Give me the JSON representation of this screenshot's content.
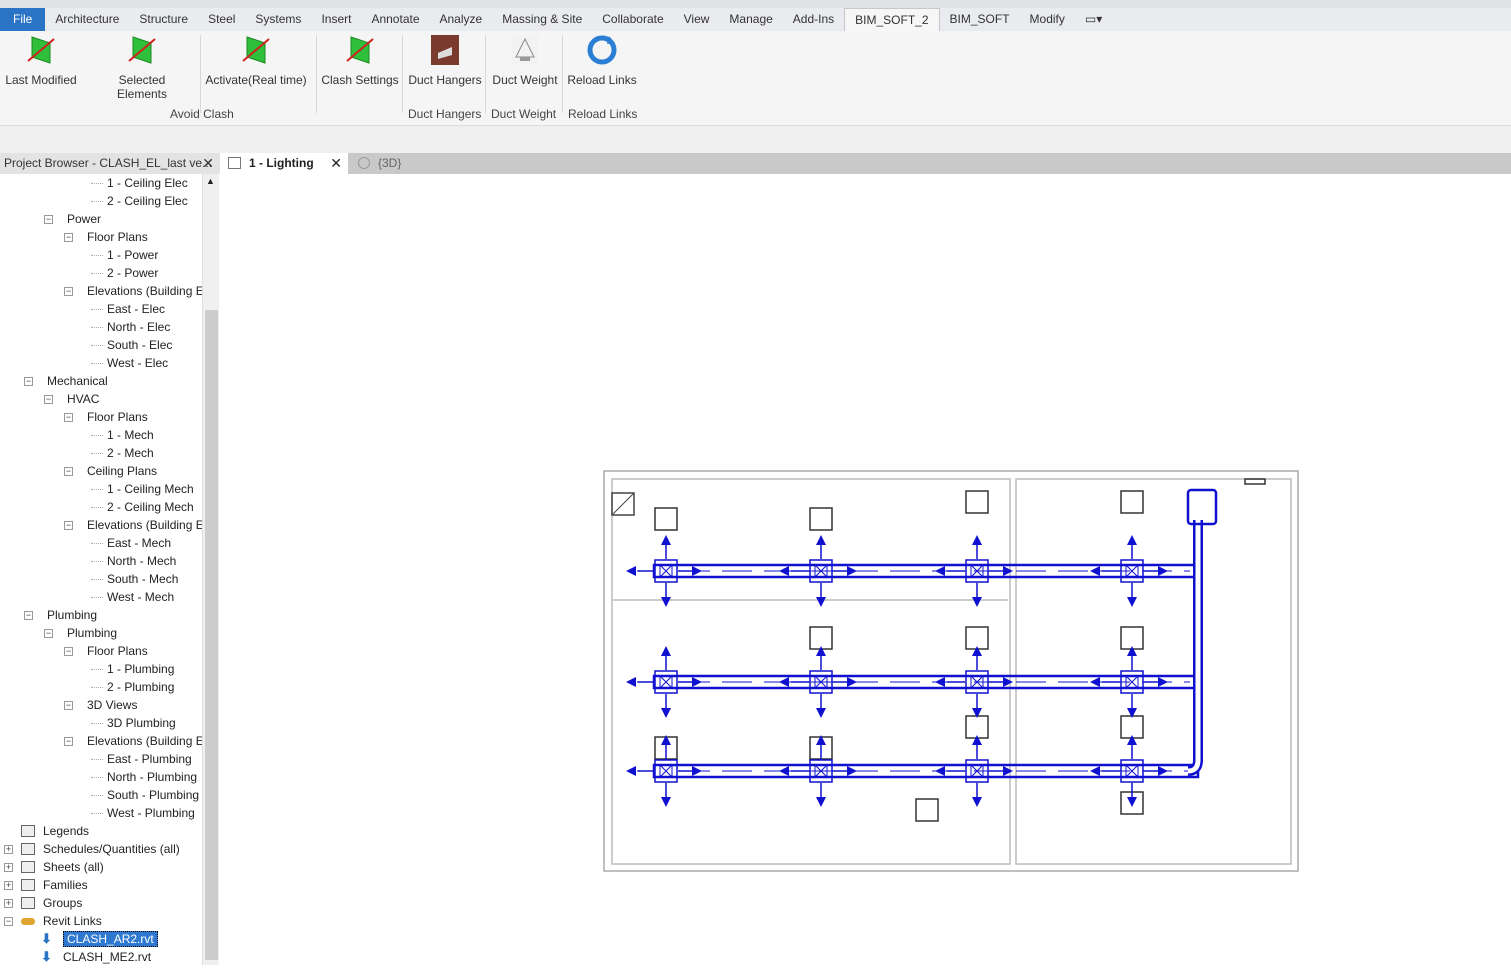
{
  "menu": {
    "tabs": [
      "File",
      "Architecture",
      "Structure",
      "Steel",
      "Systems",
      "Insert",
      "Annotate",
      "Analyze",
      "Massing & Site",
      "Collaborate",
      "View",
      "Manage",
      "Add-Ins",
      "BIM_SOFT_2",
      "BIM_SOFT",
      "Modify"
    ],
    "active": "BIM_SOFT_2"
  },
  "ribbon": {
    "buttons": [
      "Last Modified",
      "Selected Elements",
      "Activate(Real time)",
      "Clash Settings",
      "Duct Hangers",
      "Duct Weight",
      "Reload Links"
    ],
    "groups": [
      "Avoid Clash",
      "Duct Hangers",
      "Duct Weight",
      "Reload Links"
    ],
    "accent": "#2a73c5"
  },
  "project_browser": {
    "title": "Project Browser - CLASH_EL_last ve...",
    "items": [
      {
        "label": "1 - Ceiling Elec",
        "level": 4
      },
      {
        "label": "2 - Ceiling Elec",
        "level": 4
      },
      {
        "label": "Power",
        "level": 1,
        "toggle": "-"
      },
      {
        "label": "Floor Plans",
        "level": 2,
        "toggle": "-"
      },
      {
        "label": "1 - Power",
        "level": 4
      },
      {
        "label": "2 - Power",
        "level": 4
      },
      {
        "label": "Elevations (Building E",
        "level": 2,
        "toggle": "-"
      },
      {
        "label": "East - Elec",
        "level": 4
      },
      {
        "label": "North - Elec",
        "level": 4
      },
      {
        "label": "South - Elec",
        "level": 4
      },
      {
        "label": "West - Elec",
        "level": 4
      },
      {
        "label": "Mechanical",
        "level": 0,
        "toggle": "-"
      },
      {
        "label": "HVAC",
        "level": 1,
        "toggle": "-"
      },
      {
        "label": "Floor Plans",
        "level": 2,
        "toggle": "-"
      },
      {
        "label": "1 - Mech",
        "level": 4
      },
      {
        "label": "2 - Mech",
        "level": 4
      },
      {
        "label": "Ceiling Plans",
        "level": 2,
        "toggle": "-"
      },
      {
        "label": "1 - Ceiling Mech",
        "level": 4
      },
      {
        "label": "2 - Ceiling Mech",
        "level": 4
      },
      {
        "label": "Elevations (Building E",
        "level": 2,
        "toggle": "-"
      },
      {
        "label": "East - Mech",
        "level": 4
      },
      {
        "label": "North - Mech",
        "level": 4
      },
      {
        "label": "South - Mech",
        "level": 4
      },
      {
        "label": "West - Mech",
        "level": 4
      },
      {
        "label": "Plumbing",
        "level": 0,
        "toggle": "-"
      },
      {
        "label": "Plumbing",
        "level": 1,
        "toggle": "-"
      },
      {
        "label": "Floor Plans",
        "level": 2,
        "toggle": "-"
      },
      {
        "label": "1 - Plumbing",
        "level": 4
      },
      {
        "label": "2 - Plumbing",
        "level": 4
      },
      {
        "label": "3D Views",
        "level": 2,
        "toggle": "-"
      },
      {
        "label": "3D Plumbing",
        "level": 4
      },
      {
        "label": "Elevations (Building E",
        "level": 2,
        "toggle": "-"
      },
      {
        "label": "East - Plumbing",
        "level": 4
      },
      {
        "label": "North - Plumbing",
        "level": 4
      },
      {
        "label": "South - Plumbing",
        "level": 4
      },
      {
        "label": "West - Plumbing",
        "level": 4
      },
      {
        "label": "Legends",
        "level": -1,
        "icon": "legend-icon"
      },
      {
        "label": "Schedules/Quantities (all)",
        "level": -1,
        "icon": "schedule-icon",
        "toggle": "+"
      },
      {
        "label": "Sheets (all)",
        "level": -1,
        "icon": "sheet-icon",
        "toggle": "+"
      },
      {
        "label": "Families",
        "level": -1,
        "icon": "family-icon",
        "toggle": "+"
      },
      {
        "label": "Groups",
        "level": -1,
        "icon": "group-icon",
        "toggle": "+"
      },
      {
        "label": "Revit Links",
        "level": -1,
        "icon": "link-icon",
        "toggle": "-"
      },
      {
        "label": "CLASH_AR2.rvt",
        "level": 1,
        "icon": "link-file-icon",
        "selected": true
      },
      {
        "label": "CLASH_ME2.rvt",
        "level": 1,
        "icon": "link-file-icon"
      }
    ]
  },
  "view_tabs": [
    {
      "label": "1 - Lighting",
      "active": true
    },
    {
      "label": "{3D}",
      "active": false
    }
  ],
  "drawing": {
    "duct_color": "#1010d0"
  }
}
